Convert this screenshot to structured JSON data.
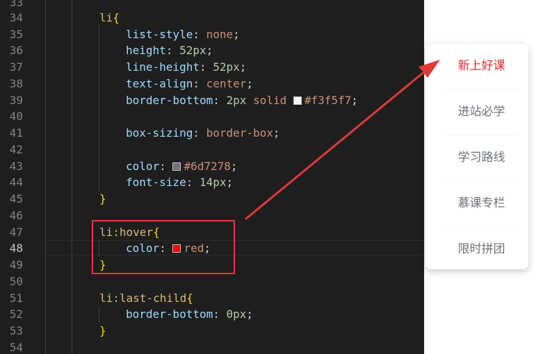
{
  "editor": {
    "line_numbers": [
      "33",
      "34",
      "35",
      "36",
      "37",
      "38",
      "39",
      "40",
      "41",
      "42",
      "43",
      "44",
      "45",
      "46",
      "47",
      "48",
      "49",
      "50",
      "51",
      "52",
      "53",
      "54"
    ],
    "active_line": "48",
    "code": {
      "l34_selector": "li",
      "l34_brace": "{",
      "l35_prop": "list-style",
      "l35_value": "none",
      "l36_prop": "height",
      "l36_value": "52px",
      "l37_prop": "line-height",
      "l37_value": "52px",
      "l38_prop": "text-align",
      "l38_value": "center",
      "l39_prop": "border-bottom",
      "l39_num": "2px",
      "l39_style": "solid",
      "l39_color": "#f3f5f7",
      "l41_prop": "box-sizing",
      "l41_value": "border-box",
      "l43_prop": "color",
      "l43_color": "#6d7278",
      "l44_prop": "font-size",
      "l44_value": "14px",
      "l45_brace": "}",
      "l47_selector": "li:hover",
      "l47_brace": "{",
      "l48_prop": "color",
      "l48_value": "red",
      "l49_brace": "}",
      "l51_selector": "li:last-child",
      "l51_brace": "{",
      "l52_prop": "border-bottom",
      "l52_value": "0px",
      "l53_brace": "}"
    },
    "swatch_colors": {
      "l39": "#f3f5f7",
      "l43": "#6d7278",
      "l48": "#ff0000"
    }
  },
  "annotation": {
    "color": "#e03a3a"
  },
  "menu": {
    "items": [
      "新上好课",
      "进站必学",
      "学习路线",
      "慕课专栏",
      "限时拼团"
    ],
    "hover_color": "#e52a2a",
    "text_color": "#6d7278"
  }
}
